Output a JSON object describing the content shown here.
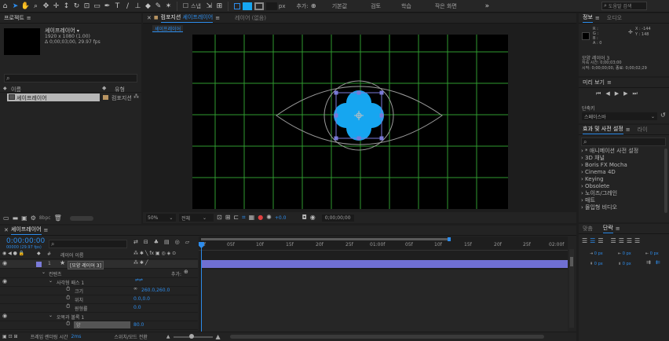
{
  "toolbar": {
    "search_placeholder": "도움말 검색",
    "workspaces": [
      "기본값",
      "검토",
      "학습",
      "작은 화면"
    ],
    "snap_label": "스냅",
    "px_label": "px",
    "add_label": "추가:"
  },
  "project_panel": {
    "title": "프로젝트",
    "menu_icon": "≡",
    "comp_name": "셰이프레이어",
    "comp_size": "1920 x 1080 (1.00)",
    "comp_duration": "Δ 0;00;03;00, 29.97 fps",
    "search_placeholder": "",
    "col_name": "이름",
    "col_type": "유형",
    "item_name": "셰이프레이어",
    "item_type": "컴포지션",
    "bpc_label": "8bpc"
  },
  "comp_panel": {
    "tab_label": "컴포지션",
    "tab_comp": "셰이프레이어",
    "menu_icon": "≡",
    "layer_tab": "레이어 (없음)",
    "breadcrumb": "셰이프레이어",
    "zoom": "50%",
    "resolution": "전체",
    "exposure": "+0.0",
    "timecode": "0;00;00;00"
  },
  "info_panel": {
    "tab_info": "정보",
    "tab_audio": "오디오",
    "r": "R :",
    "g": "G :",
    "b": "B :",
    "a": "A : 0",
    "x": "X : -144",
    "y": "Y : 148",
    "layer_line": "모양 레이어 3",
    "duration_line": "지속 시간: 0;00;03;00",
    "in_out_line": "시작: 0;00;00;00, 종료: 0;00;02;29"
  },
  "preview_panel": {
    "title": "미리 보기",
    "shortcut_label": "단축키",
    "shortcut_value": "스페이스바"
  },
  "effects_panel": {
    "title": "효과 및 사전 설정",
    "tab_lib": "라이",
    "items": [
      "* 애니메이션 사전 설정",
      "3D 채널",
      "Boris FX Mocha",
      "Cinema 4D",
      "Keying",
      "Obsolete",
      "노이즈/그레인",
      "매트",
      "몰입형 비디오"
    ]
  },
  "align_panel": {
    "tab_align": "맞춤",
    "tab_para": "단락",
    "menu_icon": "≡",
    "values": [
      "0 px",
      "0 px",
      "0 px",
      "0 px",
      "0 px"
    ]
  },
  "timeline": {
    "tab_label": "셰이프레이어",
    "menu_icon": "≡",
    "timecode": "0:00:00:00",
    "fps_label": "00000 (29.97 fps)",
    "col_source": "레이어 이름",
    "layer_num": "1",
    "layer_name": "[모양 레이어 3]",
    "contents_label": "컨텐츠",
    "add_label": "추가:",
    "rect_path": "사각형 패스 1",
    "size_label": "크기",
    "size_value": "260.0,260.0",
    "pos_label": "위치",
    "pos_value": "0.0,0.0",
    "round_label": "원형률",
    "round_value": "0.0",
    "pucker_label": "오목과 볼록 1",
    "amount_label": "양",
    "amount_value": "80.0",
    "render_label": "프레임 렌더링 시간",
    "render_value": "2ms",
    "switch_label": "스위치/모드 전환",
    "ruler": [
      "0f",
      "05f",
      "10f",
      "15f",
      "20f",
      "25f",
      "01:00f",
      "05f",
      "10f",
      "15f",
      "20f",
      "25f",
      "02:00f"
    ]
  },
  "colors": {
    "accent": "#2d8ceb",
    "shape_fill": "#16a6f0",
    "grid": "#2f9a2f",
    "layer_bar": "#6f6fd2",
    "layer_label": "#7b7bd9"
  }
}
